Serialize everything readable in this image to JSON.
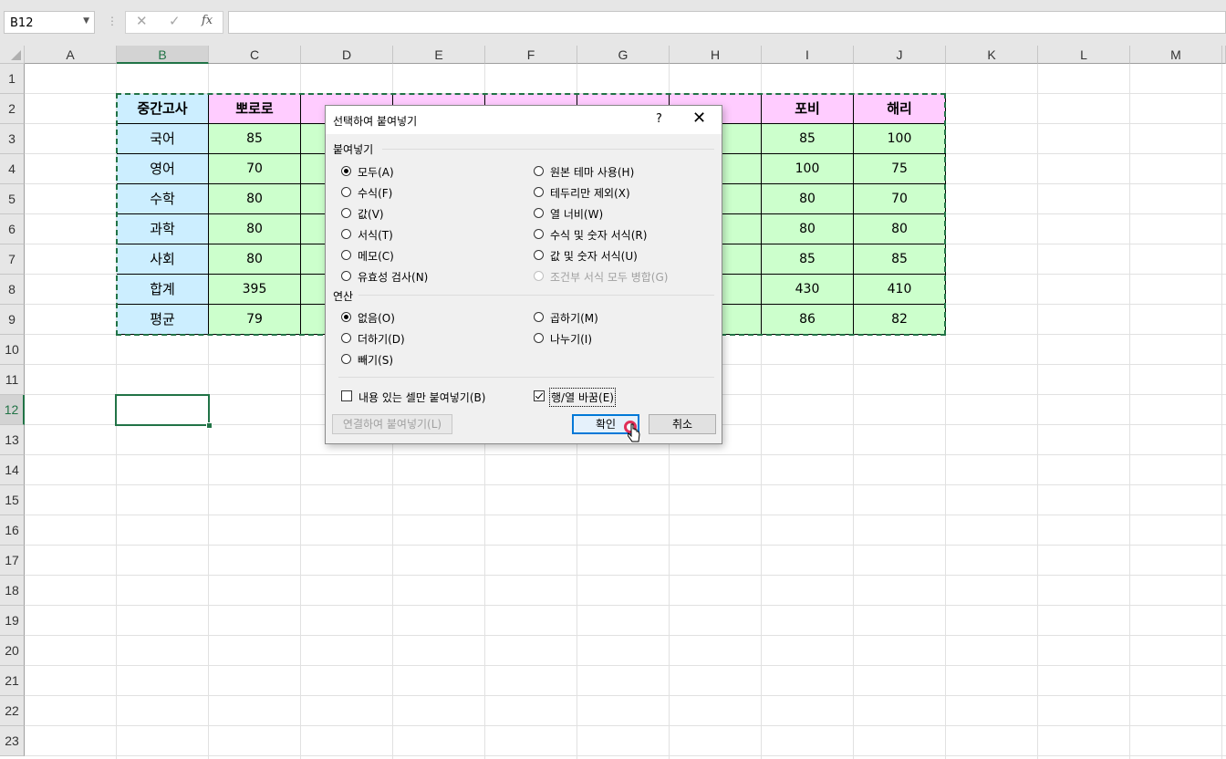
{
  "formula_bar": {
    "name_box": "B12",
    "cancel_icon": "✕",
    "enter_icon": "✓",
    "fx_label": "fx",
    "formula": ""
  },
  "grid": {
    "columns": [
      "A",
      "B",
      "C",
      "D",
      "E",
      "F",
      "G",
      "H",
      "I",
      "J",
      "K",
      "L",
      "M"
    ],
    "selected_column": "B",
    "rows": [
      "1",
      "2",
      "3",
      "4",
      "5",
      "6",
      "7",
      "8",
      "9",
      "10",
      "11",
      "12",
      "13",
      "14",
      "15",
      "16",
      "17",
      "18",
      "19",
      "20",
      "21",
      "22",
      "23"
    ],
    "selected_row": "12",
    "table": {
      "headers": [
        "중간고사",
        "뽀로로",
        "",
        "",
        "",
        "",
        "",
        "포비",
        "해리"
      ],
      "rows": [
        {
          "label": "국어",
          "values": [
            "85",
            "",
            "",
            "",
            "",
            "",
            "85",
            "100"
          ]
        },
        {
          "label": "영어",
          "values": [
            "70",
            "",
            "",
            "",
            "",
            "",
            "100",
            "75"
          ]
        },
        {
          "label": "수학",
          "values": [
            "80",
            "",
            "",
            "",
            "",
            "",
            "80",
            "70"
          ]
        },
        {
          "label": "과학",
          "values": [
            "80",
            "",
            "",
            "",
            "",
            "",
            "80",
            "80"
          ]
        },
        {
          "label": "사회",
          "values": [
            "80",
            "",
            "",
            "",
            "",
            "",
            "85",
            "85"
          ]
        },
        {
          "label": "합계",
          "values": [
            "395",
            "",
            "",
            "",
            "",
            "",
            "430",
            "410"
          ]
        },
        {
          "label": "평균",
          "values": [
            "79",
            "",
            "",
            "",
            "",
            "",
            "86",
            "82"
          ]
        }
      ]
    }
  },
  "dialog": {
    "title": "선택하여 붙여넣기",
    "help": "?",
    "close": "✕",
    "paste_group": "붙여넣기",
    "paste_options_left": [
      {
        "label": "모두(A)",
        "checked": true
      },
      {
        "label": "수식(F)",
        "checked": false
      },
      {
        "label": "값(V)",
        "checked": false
      },
      {
        "label": "서식(T)",
        "checked": false
      },
      {
        "label": "메모(C)",
        "checked": false
      },
      {
        "label": "유효성 검사(N)",
        "checked": false
      }
    ],
    "paste_options_right": [
      {
        "label": "원본 테마 사용(H)",
        "checked": false,
        "disabled": false
      },
      {
        "label": "테두리만 제외(X)",
        "checked": false,
        "disabled": false
      },
      {
        "label": "열 너비(W)",
        "checked": false,
        "disabled": false
      },
      {
        "label": "수식 및 숫자 서식(R)",
        "checked": false,
        "disabled": false
      },
      {
        "label": "값 및 숫자 서식(U)",
        "checked": false,
        "disabled": false
      },
      {
        "label": "조건부 서식 모두 병합(G)",
        "checked": false,
        "disabled": true
      }
    ],
    "operation_group": "연산",
    "operation_options_left": [
      {
        "label": "없음(O)",
        "checked": true
      },
      {
        "label": "더하기(D)",
        "checked": false
      },
      {
        "label": "빼기(S)",
        "checked": false
      }
    ],
    "operation_options_right": [
      {
        "label": "곱하기(M)",
        "checked": false
      },
      {
        "label": "나누기(I)",
        "checked": false
      }
    ],
    "skip_blanks": {
      "label": "내용 있는 셀만 붙여넣기(B)",
      "checked": false
    },
    "transpose": {
      "label": "행/열 바꿈(E)",
      "checked": true
    },
    "paste_link_button": "연결하여 붙여넣기(L)",
    "ok_button": "확인",
    "cancel_button": "취소"
  }
}
